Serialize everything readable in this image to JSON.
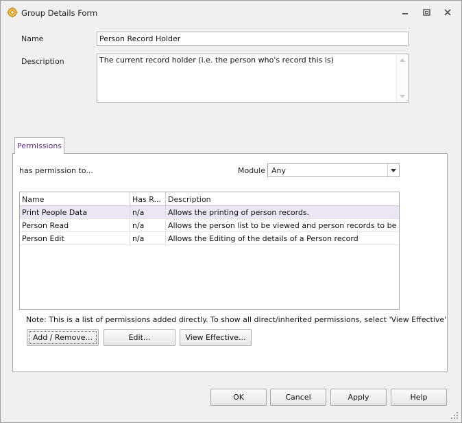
{
  "window": {
    "title": "Group Details Form",
    "icon": "gear-group-icon",
    "controls": {
      "minimize": "minimize-icon",
      "maximize": "maximize-icon",
      "close": "close-icon"
    }
  },
  "form": {
    "name_label": "Name",
    "name_value": "Person Record Holder",
    "description_label": "Description",
    "description_value": "The current record holder (i.e. the person who's record this is)"
  },
  "tabs": [
    {
      "label": "Permissions"
    }
  ],
  "permissions": {
    "has_permission_label": "has permission to...",
    "module_label": "Module",
    "module_value": "Any",
    "columns": [
      "Name",
      "Has R...",
      "Description"
    ],
    "rows": [
      {
        "name": "Print People Data",
        "has": "n/a",
        "description": "Allows the printing of person records."
      },
      {
        "name": "Person Read",
        "has": "n/a",
        "description": "Allows the person list to be viewed and person records to be opened."
      },
      {
        "name": "Person Edit",
        "has": "n/a",
        "description": "Allows the Editing of the details of a Person record"
      }
    ],
    "note": "Note: This is a list of permissions added directly. To show all direct/inherited permissions, select 'View Effective'",
    "add_remove_label": "Add / Remove...",
    "edit_label": "Edit...",
    "view_effective_label": "View  Effective..."
  },
  "footer": {
    "ok_label": "OK",
    "cancel_label": "Cancel",
    "apply_label": "Apply",
    "help_label": "Help"
  },
  "colors": {
    "tab_text": "#5a2d82",
    "selected_row": "#ece5f3"
  }
}
